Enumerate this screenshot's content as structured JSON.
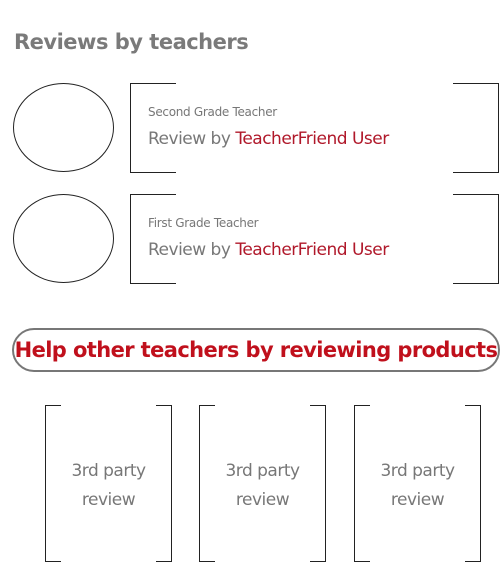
{
  "section": {
    "title": "Reviews by teachers"
  },
  "reviews": [
    {
      "role": "Second Grade Teacher",
      "prefix": "Review by ",
      "user": "TeacherFriend User"
    },
    {
      "role": "First Grade Teacher",
      "prefix": "Review by ",
      "user": "TeacherFriend User"
    }
  ],
  "cta": {
    "label": "Help other teachers by reviewing products"
  },
  "third_party": [
    {
      "line1": "3rd party",
      "line2": "review"
    },
    {
      "line1": "3rd party",
      "line2": "review"
    },
    {
      "line1": "3rd party",
      "line2": "review"
    }
  ],
  "colors": {
    "accent": "#c0101c",
    "user_link": "#b0182a",
    "text": "#777777",
    "line": "#222222"
  }
}
